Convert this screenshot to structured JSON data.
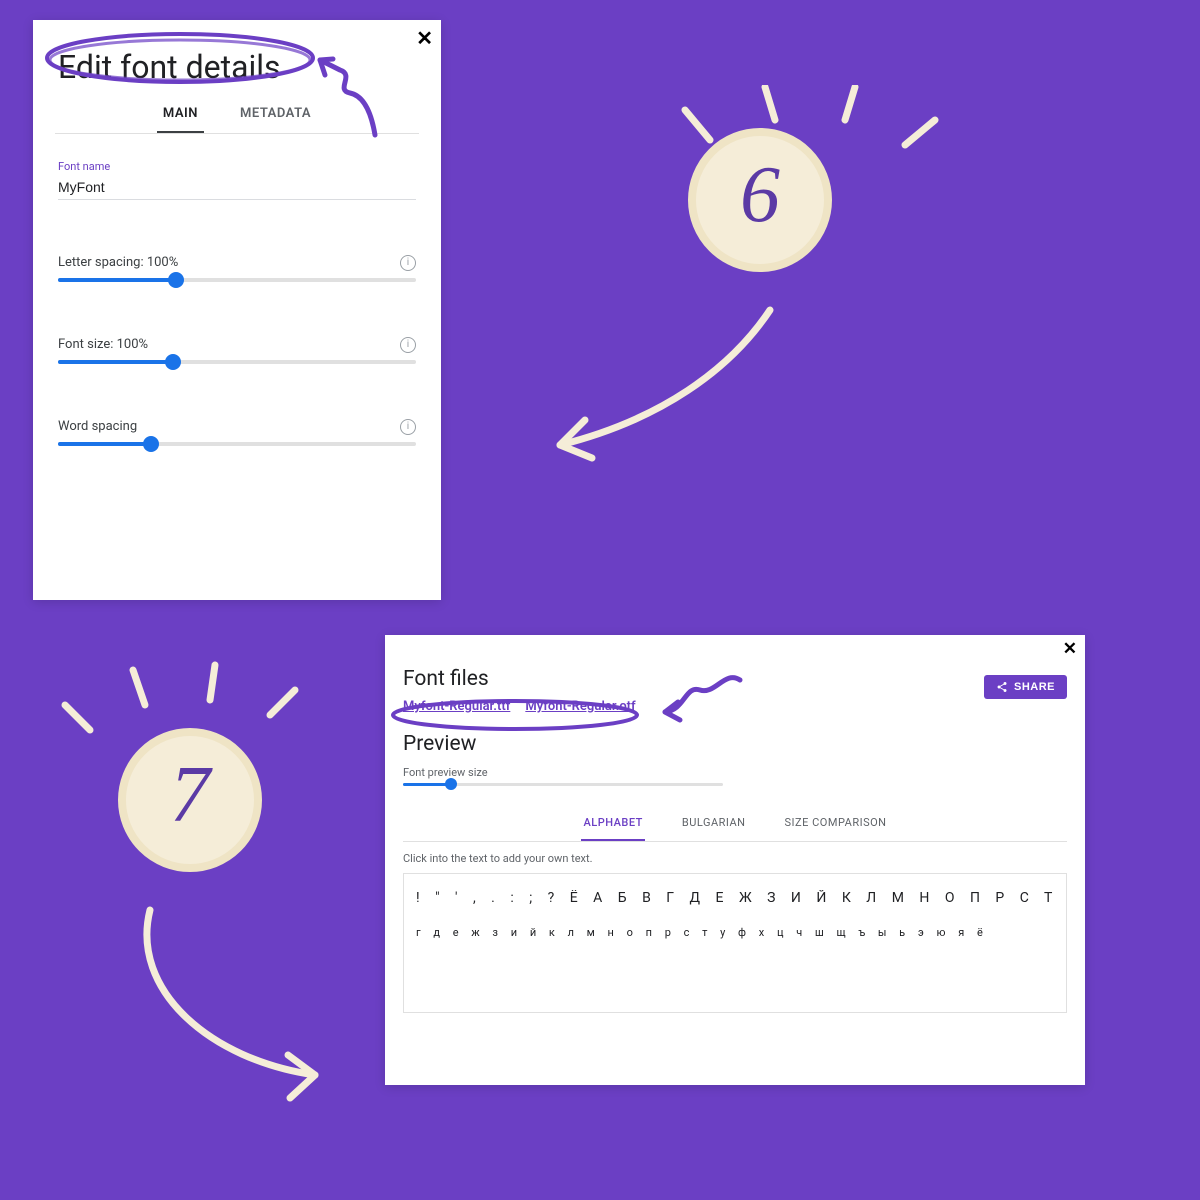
{
  "panel1": {
    "title": "Edit font details",
    "close": "✕",
    "tabs": {
      "main": "MAIN",
      "metadata": "METADATA"
    },
    "font_name_label": "Font name",
    "font_name_value": "MyFont",
    "letter_spacing_label": "Letter spacing: 100%",
    "letter_spacing_pct": 33,
    "font_size_label": "Font size: 100%",
    "font_size_pct": 32,
    "word_spacing_label": "Word spacing",
    "word_spacing_pct": 26
  },
  "panel2": {
    "close": "✕",
    "heading_files": "Font files",
    "file_ttf": "Myfont-Regular.ttf",
    "file_otf": "Myfont-Regular.otf",
    "share_label": "SHARE",
    "heading_preview": "Preview",
    "preview_size_label": "Font preview size",
    "tabs": {
      "alphabet": "ALPHABET",
      "bulgarian": "BULGARIAN",
      "size": "SIZE COMPARISON"
    },
    "hint": "Click into the text to add your own text.",
    "glyph_row1": "! \" ' , . : ; ? Ё А Б В Г Д Е Ж З И Й К Л М Н О П Р С Т У Ф Х Ц Ч Ш Щ Ъ Ы Ь Э Ю Я а б в",
    "glyph_row2": "г д е ж з и й к л м н о п р с т у ф х ц ч ш щ ъ ы ь э ю я ё"
  },
  "badges": {
    "six": "6",
    "seven": "7"
  }
}
